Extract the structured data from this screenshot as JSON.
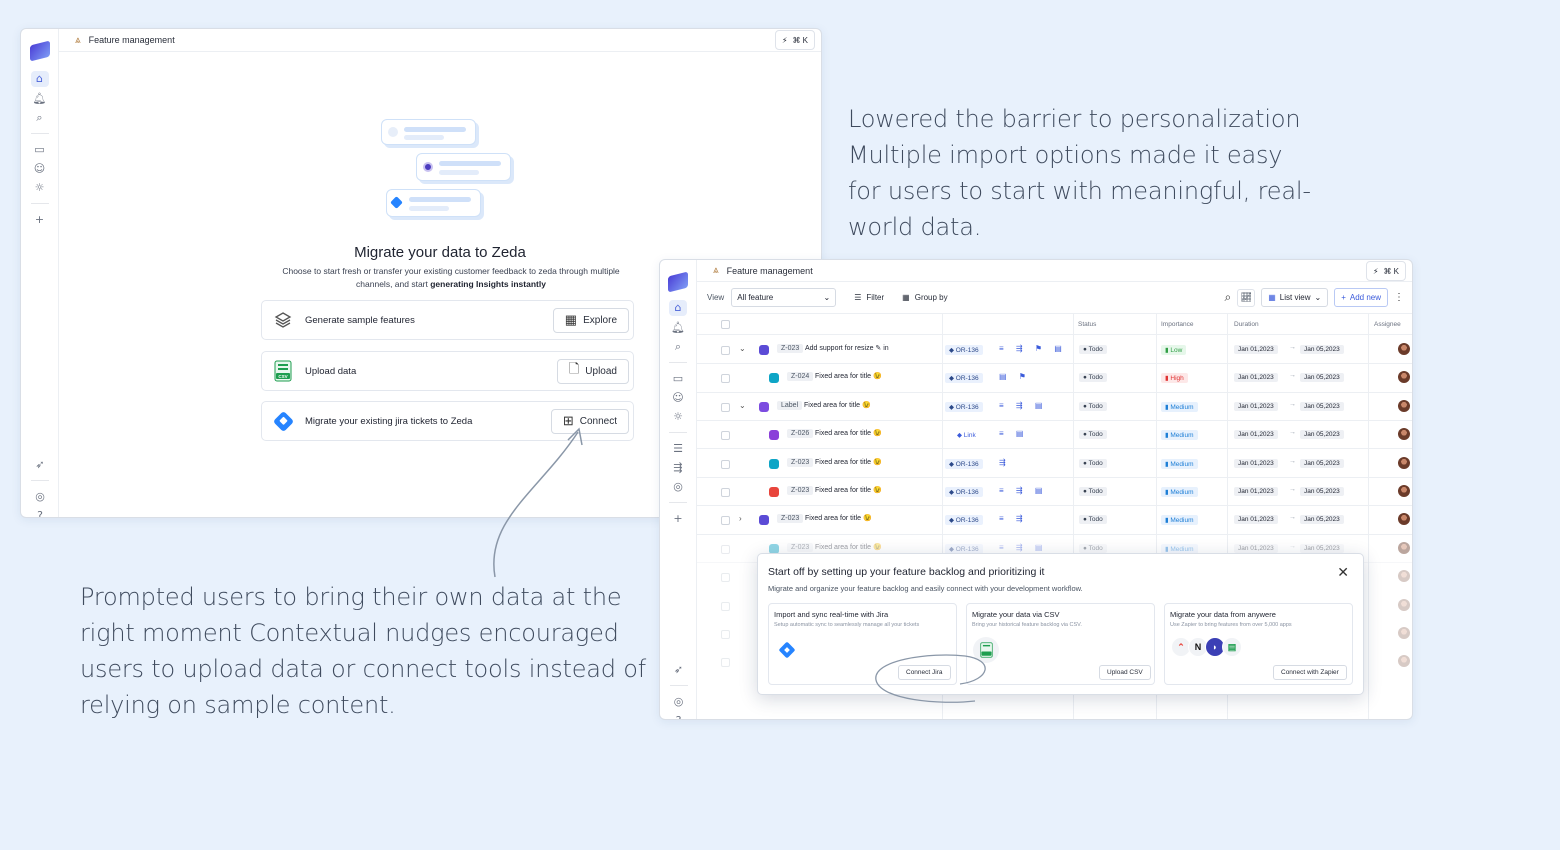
{
  "captions": {
    "top_heading": "Lowered the barrier to personalization",
    "top_body": "Multiple import options made it easy for users to start with meaningful, real-world data.",
    "bottom_heading": "Prompted users to bring their own data at the right moment",
    "bottom_body": "Contextual nudges encouraged users to upload data or connect tools instead of relying on sample content."
  },
  "window1": {
    "breadcrumb": "Feature management",
    "shortcut": "⌘ K",
    "title": "Migrate your data to Zeda",
    "subtitle_pre": "Choose to start fresh or transfer your existing customer feedback to zeda through multiple channels, and start ",
    "subtitle_bold": "generating Insights instantly",
    "options": [
      {
        "label": "Generate sample features",
        "button": "Explore",
        "icon": "layers-icon"
      },
      {
        "label": "Upload data",
        "button": "Upload",
        "icon": "csv-icon"
      },
      {
        "label": "Migrate your existing jira tickets to Zeda",
        "button": "Connect",
        "icon": "jira-icon"
      }
    ]
  },
  "window2": {
    "breadcrumb": "Feature management",
    "shortcut": "⌘ K",
    "toolbar": {
      "view_label": "View",
      "view_value": "All feature",
      "filter": "Filter",
      "group_by": "Group by",
      "list_view": "List view",
      "add_new": "Add new"
    },
    "columns": {
      "status": "Status",
      "importance": "Importance",
      "duration": "Duration",
      "assignee": "Assignee"
    },
    "rows": [
      {
        "id": "Z-023",
        "title": "Add support for resize ✎ in",
        "tag": "OR-136",
        "status": "Todo",
        "importance": "Low",
        "start": "Jan 01,2023",
        "end": "Jan 05,2023",
        "chevron": "⌄",
        "icons": "≡ ⇶ ⚑ ▤"
      },
      {
        "id": "Z-024",
        "title": "Fixed area for title 😉",
        "tag": "OR-136",
        "status": "Todo",
        "importance": "High",
        "start": "Jan 01,2023",
        "end": "Jan 05,2023",
        "chevron": "",
        "icons": "▤ ⚑"
      },
      {
        "id": "Label",
        "title": "Fixed area for title 😉",
        "tag": "OR-136",
        "status": "Todo",
        "importance": "Medium",
        "start": "Jan 01,2023",
        "end": "Jan 05,2023",
        "chevron": "⌄",
        "icons": "≡ ⇶ ▤"
      },
      {
        "id": "Z-026",
        "title": "Fixed area for title 😉",
        "tag": "Link",
        "status": "Todo",
        "importance": "Medium",
        "start": "Jan 01,2023",
        "end": "Jan 05,2023",
        "chevron": "",
        "icons": "≡ ▤"
      },
      {
        "id": "Z-023",
        "title": "Fixed area for title 😉",
        "tag": "OR-136",
        "status": "Todo",
        "importance": "Medium",
        "start": "Jan 01,2023",
        "end": "Jan 05,2023",
        "chevron": "",
        "icons": "⇶"
      },
      {
        "id": "Z-023",
        "title": "Fixed area for title 😉",
        "tag": "OR-136",
        "status": "Todo",
        "importance": "Medium",
        "start": "Jan 01,2023",
        "end": "Jan 05,2023",
        "chevron": "",
        "icons": "≡ ⇶ ▤"
      },
      {
        "id": "Z-023",
        "title": "Fixed area for title 😉",
        "tag": "OR-136",
        "status": "Todo",
        "importance": "Medium",
        "start": "Jan 01,2023",
        "end": "Jan 05,2023",
        "chevron": "›",
        "icons": "≡ ⇶"
      },
      {
        "id": "Z-023",
        "title": "Fixed area for title 😉",
        "tag": "OR-136",
        "status": "Todo",
        "importance": "Medium",
        "start": "Jan 01,2023",
        "end": "Jan 05,2023",
        "chevron": "",
        "icons": "≡ ⇶ ▤"
      }
    ],
    "modal": {
      "title": "Start off by setting up your feature backlog and prioritizing it",
      "subtitle": "Migrate and organize your feature backlog and easily connect with your development workflow.",
      "cards": [
        {
          "title": "Import and sync real-time with Jira",
          "desc": "Setup automatic sync to seamlessly manage all your tickets",
          "button": "Connect Jira"
        },
        {
          "title": "Migrate your data via CSV",
          "desc": "Bring your historical feature backlog via CSV.",
          "button": "Upload CSV"
        },
        {
          "title": "Migrate your data from anywere",
          "desc": "Use Zapier to bring features from over 5,000 apps",
          "button": "Connect with Zapier"
        }
      ]
    }
  },
  "colors": {
    "background": "#e8f1fc",
    "accent": "#3b5bdb",
    "jira": "#2684ff",
    "csv": "#1e9e4f",
    "low": "#2f9e44",
    "high": "#e03131",
    "medium": "#1c7ed6"
  }
}
